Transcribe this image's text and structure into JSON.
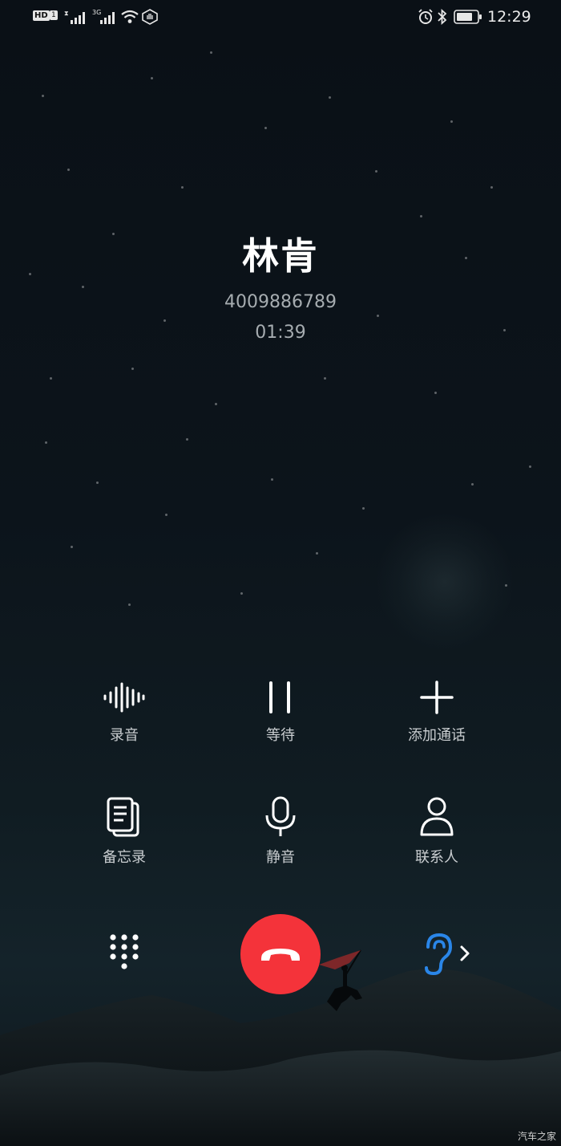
{
  "status_bar": {
    "hd_label": "HD",
    "sim1_label": "1",
    "sim2_net_label": "3G",
    "time": "12:29"
  },
  "call": {
    "caller_name": "林肯",
    "phone_number": "4009886789",
    "duration": "01:39"
  },
  "actions": {
    "record": "录音",
    "hold": "等待",
    "add_call": "添加通话",
    "notes": "备忘录",
    "mute": "静音",
    "contacts": "联系人"
  },
  "bottom_bar": {
    "dialpad_icon": "dialpad-icon",
    "end_call_icon": "end-call-icon",
    "earpiece_icon": "ear-icon"
  },
  "colors": {
    "end_call": "#f4333a",
    "earpiece_accent": "#2a86e8"
  },
  "watermark": "汽车之家"
}
